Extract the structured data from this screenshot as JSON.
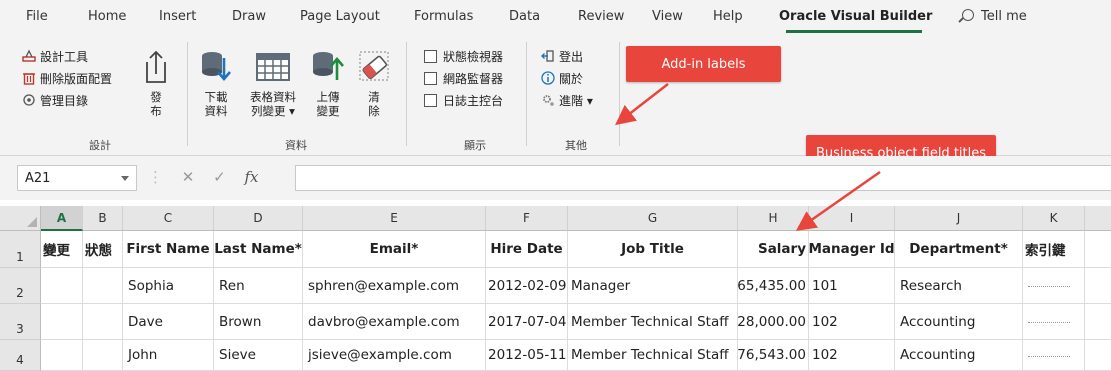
{
  "tabs": [
    {
      "label": "File"
    },
    {
      "label": "Home"
    },
    {
      "label": "Insert"
    },
    {
      "label": "Draw"
    },
    {
      "label": "Page Layout"
    },
    {
      "label": "Formulas"
    },
    {
      "label": "Data"
    },
    {
      "label": "Review"
    },
    {
      "label": "View"
    },
    {
      "label": "Help"
    },
    {
      "label": "Oracle Visual Builder"
    }
  ],
  "active_tab": "Oracle Visual Builder",
  "tell_me": "Tell me",
  "ribbon": {
    "design_group": {
      "label": "設計",
      "commands": [
        {
          "label": "設計工具",
          "icon": "designer-icon"
        },
        {
          "label": "刪除版面配置",
          "icon": "delete-layout-icon"
        },
        {
          "label": "管理目錄",
          "icon": "manage-catalog-icon"
        }
      ],
      "publish": "發\n布"
    },
    "data_group": {
      "label": "資料",
      "download": "下載\n資料",
      "table_changes": "表格資料\n列變更 ▾",
      "upload": "上傳\n變更",
      "clear": "清\n除"
    },
    "show_group": {
      "label": "顯示",
      "checkboxes": [
        {
          "label": "狀態檢視器"
        },
        {
          "label": "網路監督器"
        },
        {
          "label": "日誌主控台"
        }
      ]
    },
    "other_group": {
      "label": "其他",
      "commands": [
        {
          "label": "登出"
        },
        {
          "label": "關於"
        },
        {
          "label": "進階 ▾"
        }
      ]
    }
  },
  "callouts": {
    "addin": "Add-in labels",
    "fields": "Business object field titles"
  },
  "formula_bar": {
    "name_box": "A21",
    "cancel": "✕",
    "enter": "✓",
    "fx": "fx",
    "value": ""
  },
  "grid": {
    "selected_column": "A",
    "columns": [
      "A",
      "B",
      "C",
      "D",
      "E",
      "F",
      "G",
      "H",
      "I",
      "J",
      "K"
    ],
    "row_numbers": [
      "1",
      "2",
      "3",
      "4"
    ],
    "header_row": [
      "變更",
      "狀態",
      "First Name",
      "Last Name*",
      "Email*",
      "Hire Date",
      "Job Title",
      "Salary",
      "Manager Id",
      "Department*",
      "索引鍵"
    ],
    "rows": [
      {
        "first": "Sophia",
        "last": "Ren",
        "email": "sphren@example.com",
        "hire": "2012-02-09",
        "job": "Manager",
        "salary": "65,435.00",
        "manager": "101",
        "dept": "Research"
      },
      {
        "first": "Dave",
        "last": "Brown",
        "email": "davbro@example.com",
        "hire": "2017-07-04",
        "job": "Member Technical Staff",
        "salary": "28,000.00",
        "manager": "102",
        "dept": "Accounting"
      },
      {
        "first": "John",
        "last": "Sieve",
        "email": "jsieve@example.com",
        "hire": "2012-05-11",
        "job": "Member Technical Staff",
        "salary": "76,543.00",
        "manager": "102",
        "dept": "Accounting"
      }
    ]
  },
  "colors": {
    "accent": "#1e7145",
    "callout": "#e8453c",
    "ribbon_bg": "#f3f3f3",
    "header_bg": "#e6e6e6"
  }
}
